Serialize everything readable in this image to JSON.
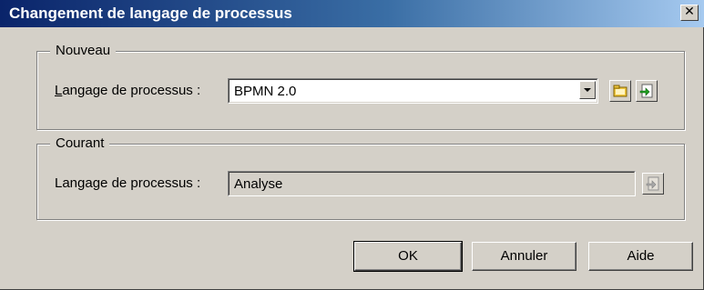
{
  "window": {
    "title": "Changement de langage de processus",
    "close_glyph": "✕"
  },
  "nouveau": {
    "legend": "Nouveau",
    "label_accel": "L",
    "label_rest": "angage de processus :",
    "value": "BPMN 2.0",
    "browse_icon": "folder-browse-icon",
    "properties_icon": "properties-arrow-icon"
  },
  "courant": {
    "legend": "Courant",
    "label": "Langage de processus :",
    "value": "Analyse",
    "properties_icon": "properties-arrow-icon"
  },
  "buttons": {
    "ok": "OK",
    "cancel": "Annuler",
    "help": "Aide"
  },
  "colors": {
    "face": "#d4d0c8",
    "title_start": "#0a246a",
    "title_end": "#a6caf0",
    "title_text": "#ffffff"
  }
}
